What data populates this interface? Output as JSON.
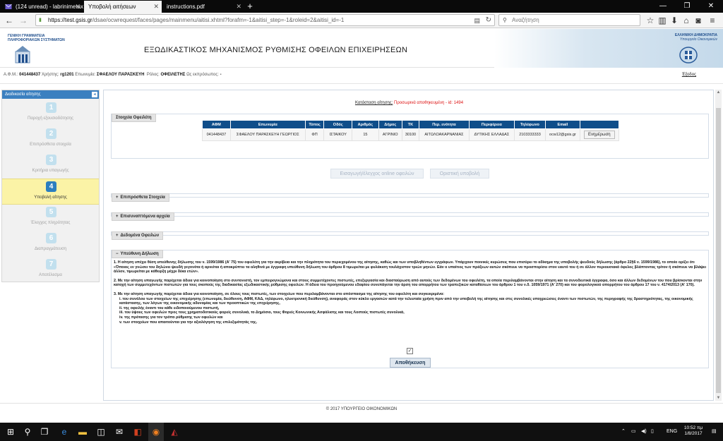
{
  "browser": {
    "tabs": [
      {
        "label": "(124 unread) - labrinimetaxas",
        "active": false
      },
      {
        "label": "Υποβολή αιτήσεων",
        "active": true
      },
      {
        "label": "instructions.pdf",
        "active": false
      }
    ],
    "new_tab": "+",
    "url_domain": "https://test.gsis.gr",
    "url_path": "/dsae/ocwrequest/faces/pages/mainmenu/aitisi.xhtml?forafm=-1&aitisi_step=-1&roleid=2&aitisi_id=-1",
    "search_placeholder": "Αναζήτηση"
  },
  "header": {
    "left_logo_line1": "ΓΕΝΙΚΗ ΓΡΑΜΜΑΤΕΙΑ",
    "left_logo_line2": "ΠΛΗΡΟΦΟΡΙΑΚΩΝ ΣΥΣΤΗΜΑΤΩΝ",
    "title": "ΕΞΩΔΙΚΑΣΤΙΚΟΣ ΜΗΧΑΝΙΣΜΟΣ ΡΥΘΜΙΣΗΣ ΟΦΕΙΛΩΝ ΕΠΙΧΕΙΡΗΣΕΩΝ",
    "right_logo_line1": "ΕΛΛΗΝΙΚΗ ΔΗΜΟΚΡΑΤΙΑ",
    "right_logo_line2": "Υπουργείο Οικονομικών"
  },
  "userbar": {
    "afm_label": "Α.Φ.Μ.:",
    "afm_value": "041448437",
    "user_label": "Χρήστης:",
    "user_value": "rg1201",
    "surname_label": "Επωνυμία:",
    "surname_value": "ΣΦΑΕΛΟΥ ΠΑΡΑΣΚΕΥΗ",
    "role_label": "Ρόλος:",
    "role_value": "ΟΦΕΙΛΕΤΗΣ",
    "agent_label": "Ως εκπρόσωπος:",
    "agent_value": "-",
    "exit_label": "Έξοδος"
  },
  "sidebar": {
    "title": "Διαδικασία αίτησης",
    "collapse": "◂",
    "steps": [
      {
        "num": "1",
        "label": "Παροχή εξουσιοδότησης",
        "active": false
      },
      {
        "num": "2",
        "label": "Επιπρόσθετα στοιχεία",
        "active": false
      },
      {
        "num": "3",
        "label": "Κριτήρια υπαγωγής",
        "active": false
      },
      {
        "num": "4",
        "label": "Υποβολή αίτησης",
        "active": true
      },
      {
        "num": "5",
        "label": "Έλεγχος πληρότητας",
        "active": false
      },
      {
        "num": "6",
        "label": "Διαπραγμάτευση",
        "active": false
      },
      {
        "num": "7",
        "label": "Αποτέλεσμα",
        "active": false
      }
    ]
  },
  "main": {
    "status_label": "Κατάσταση αίτησης:",
    "status_value": "Προσωρινά αποθηκευμένη - id: 1494",
    "debtor_section": "Στοιχεία Οφειλέτη",
    "table": {
      "headers": [
        "ΑΦΜ",
        "Επωνυμία",
        "Τύπος",
        "Οδός",
        "Αριθμός",
        "Δήμος",
        "ΤΚ",
        "Περ. ενότητα",
        "Περιφέρεια",
        "Τηλέφωνο",
        "Email",
        ""
      ],
      "row": [
        "041448437",
        "ΣΦΑΕΛΟΥ ΠΑΡΑΣΚΕΥΗ ΓΕΩΡΓΙΟΣ",
        "ΦΠ",
        "ΙΣΤΑΙΚΟΥ",
        "15",
        "ΑΓΡΙΝΙΟ",
        "30100",
        "ΑΙΤΩΛΟΑΚΑΡΝΑΝΙΑΣ",
        "ΔΥΤΙΚΗΣ ΕΛΛΑΔΑΣ",
        "2103333333",
        "ocw12@gsis.gr"
      ],
      "update_button": "Ενημέρωση"
    },
    "import_button": "Εισαγωγή/έλεγχος online οφειλών",
    "final_submit_button": "Οριστική υποβολή",
    "collapsed_sections": [
      {
        "toggle": "+",
        "label": "Επιπρόσθετα Στοιχεία"
      },
      {
        "toggle": "+",
        "label": "Επισυναπτόμενα αρχεία"
      },
      {
        "toggle": "+",
        "label": "Δεδομένα Οφειλών"
      }
    ],
    "declaration": {
      "toggle": "−",
      "title": "Υπεύθυνη Δήλωση",
      "p1": "1. Η αίτηση υπέχει θέση υπεύθυνης δήλωσης του ν. 1599/1986 (Α' 75) του οφειλέτη για την ακρίβεια και την πληρότητα του περιεχομένου της αίτησης, καθώς και των υποβληθέντων εγγράφων. Υπάρχουν ποινικές κυρώσεις που επισύρει το αδίκημα της υποβολής ψευδούς δήλωσης (άρθρο 22§6 ν. 1599/1986), το οποίο ορίζει ότι «Όποιος εν γνώσει του δηλώνει ψευδή γεγονότα ή αρνείται ή αποκρύπτει τα αληθινά με έγγραφη υπεύθυνη δήλωση του άρθρου 8 τιμωρείται με φυλάκιση τουλάχιστον τριών μηνών. Εάν ο υπαίτιος των πράξεων αυτών σκόπευε να προσπορίσει στον εαυτό του ή σε άλλον περιουσιακό όφελος βλάπτοντας τρίτον ή σκόπευε να βλάψει άλλον, τιμωρείται με κάθειρξη μέχρι δέκα ετών».",
      "p2": "2. Με την αίτηση υπαγωγής παρέχεται άδεια για κοινοποίηση στο συντονιστή, τον εμπειρογνώμονα και στους συμμετέχοντες πιστωτές, επεξεργασία και διασταύρωση από αυτούς των δεδομένων του οφειλέτη, τα οποία περιλαμβάνονται στην αίτηση και τα συνοδευτικά έγγραφα, όσο και άλλων δεδομένων του που βρίσκονται στην κατοχή των συμμετεχόντων πιστωτών για τους σκοπούς της διαδικασίας εξωδικαστικής ρύθμισης οφειλών. Η άδεια του προηγούμενου εδαφίου συνεπάγεται την άρση του απορρήτου των τραπεζικών καταθέσεων του άρθρου 1 του ν.δ. 1059/1971 (Α' 270) και του φορολογικού απορρήτου του άρθρου 17 του ν. 4174/2013 (Α' 170).",
      "p3": "3. Με την αίτηση υπαγωγής παρέχεται άδεια για κοινοποίηση, σε όλους τους πιστωτές, των στοιχείων που περιλαμβάνονται στο απόσπασμα της αίτησης του οφειλέτη και συγκεκριμένα:",
      "items": [
        "i. του συνόλου των στοιχείων της επιχείρησης (επωνυμία, διεύθυνση, ΑΦΜ, ΚΑΔ, τηλέφωνο, ηλεκτρονική διεύθυνση), αναφοράς στον κύκλο εργασιών κατά την τελευταία χρήση πριν από την υποβολή της αίτησης και στις συνολικές υποχρεώσεις έναντι των πιστωτών, της περιγραφής της δραστηριότητας, της οικονομικής κατάστασης, των λόγων της οικονομικής αδυναμίας και των προοπτικών της επιχείρησης,",
        "ii. της οφειλής έναντι του κάθε ειδοποιούμενου πιστωτή,",
        "iii. του ύψους των οφειλών προς τους χρηματοδοτικούς φορείς συνολικά, το Δημόσιο, τους Φορείς Κοινωνικής Ασφάλισης και τους Λοιπούς πιστωτές συνολικά,",
        "iv. της πρότασης για τον τρόπο ρύθμισης των οφειλών και",
        "v. των στοιχείων που απαιτούνται για την αξιολόγηση της επιλεξιμότητάς της."
      ],
      "checkbox_mark": "✓",
      "save_button": "Αποθήκευση"
    }
  },
  "footer": {
    "text": "© 2017 ΥΠΟΥΡΓΕΙΟ ΟΙΚΟΝΟΜΙΚΩΝ"
  },
  "taskbar": {
    "language": "ENG",
    "time": "10:52 πμ",
    "date": "1/8/2017"
  }
}
